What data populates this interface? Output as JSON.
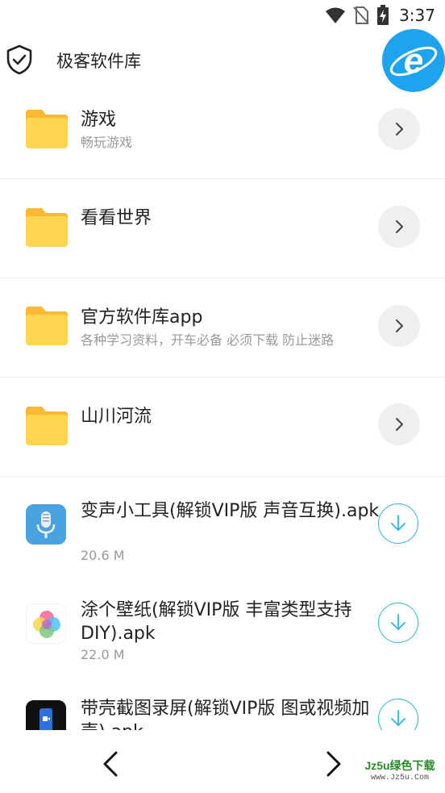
{
  "status_bar": {
    "time": "3:37",
    "icons": [
      "wifi-icon",
      "no-sim-icon",
      "battery-charging-icon"
    ]
  },
  "app_bar": {
    "title": "极客软件库",
    "left_icon": "shield-check-icon",
    "right_badge": "ie-browser-icon"
  },
  "folders": [
    {
      "title": "游戏",
      "subtitle": "畅玩游戏",
      "icon": "folder-icon",
      "action": "chevron-right-icon"
    },
    {
      "title": "看看世界",
      "subtitle": "",
      "icon": "folder-icon",
      "action": "chevron-right-icon"
    },
    {
      "title": "官方软件库app",
      "subtitle": "各种学习资料，开车必备 必须下载 防止迷路",
      "icon": "folder-icon",
      "action": "chevron-right-icon"
    },
    {
      "title": "山川河流",
      "subtitle": "",
      "icon": "folder-icon",
      "action": "chevron-right-icon"
    }
  ],
  "files": [
    {
      "title": "变声小工具(解锁VIP版 声音互换).apk",
      "size": "20.6 M",
      "icon": "microphone-app-icon",
      "action": "download-icon"
    },
    {
      "title": "涂个壁纸(解锁VIP版 丰富类型支持DIY).apk",
      "size": "22.0 M",
      "icon": "colorful-wallpaper-app-icon",
      "action": "download-icon"
    },
    {
      "title": "带壳截图录屏(解锁VIP版 图或视频加壳).apk",
      "size": "",
      "icon": "phone-recorder-app-icon",
      "action": "download-icon"
    }
  ],
  "bottom_nav": {
    "prev": "chevron-left-icon",
    "next": "chevron-right-icon"
  },
  "watermark": {
    "main": "Jz5u绿色下载",
    "sub": "www.Jz5u.Com"
  },
  "colors": {
    "accent_blue": "#2fb2ea",
    "folder_yellow": "#ffd54f",
    "ie_blue": "#1ea3f0",
    "button_grey": "#efefef"
  }
}
